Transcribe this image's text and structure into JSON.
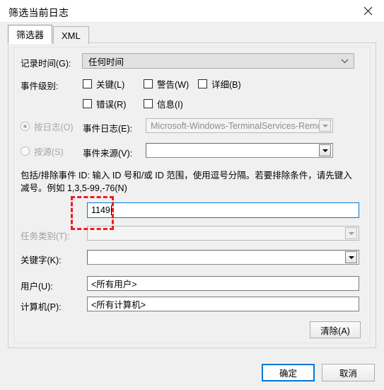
{
  "window": {
    "title": "筛选当前日志",
    "close_label": "✕"
  },
  "tabs": [
    {
      "label": "筛选器",
      "active": true
    },
    {
      "label": "XML",
      "active": false
    }
  ],
  "form": {
    "logged": {
      "label": "记录时间(G):",
      "value": "任何时间"
    },
    "event_level": {
      "label": "事件级别:",
      "options": [
        {
          "label": "关键(L)",
          "checked": false
        },
        {
          "label": "警告(W)",
          "checked": false
        },
        {
          "label": "详细(B)",
          "checked": false
        },
        {
          "label": "错误(R)",
          "checked": false
        },
        {
          "label": "信息(I)",
          "checked": false
        }
      ]
    },
    "by_log": {
      "radio_label": "按日志(O)",
      "selected": true,
      "field_label": "事件日志(E):",
      "value": "Microsoft-Windows-TerminalServices-Remote"
    },
    "by_source": {
      "radio_label": "按源(S)",
      "selected": false,
      "field_label": "事件来源(V):",
      "value": ""
    },
    "event_ids": {
      "description": "包括/排除事件 ID: 输入 ID 号和/或 ID 范围，使用逗号分隔。若要排除条件，请先键入减号。例如 1,3,5-99,-76(N)",
      "value": "1149"
    },
    "task_category": {
      "label": "任务类别(T):",
      "value": ""
    },
    "keywords": {
      "label": "关键字(K):",
      "value": ""
    },
    "user": {
      "label": "用户(U):",
      "value": "<所有用户>"
    },
    "computer": {
      "label": "计算机(P):",
      "value": "<所有计算机>"
    },
    "clear_button": "清除(A)"
  },
  "footer": {
    "ok": "确定",
    "cancel": "取消"
  },
  "annotation": {
    "color": "#ee1c25"
  }
}
